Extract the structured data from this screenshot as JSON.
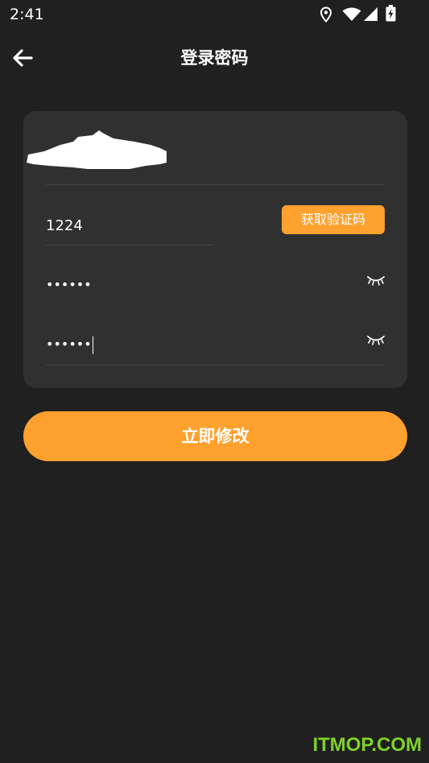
{
  "status_bar": {
    "time": "2:41",
    "icons": [
      "location-icon",
      "wifi-icon",
      "signal-icon",
      "battery-charging-icon"
    ]
  },
  "header": {
    "title": "登录密码",
    "back_icon": "arrow-left-icon"
  },
  "form": {
    "account_value_redacted": "",
    "verification_code": {
      "value": "1224"
    },
    "get_code_button": {
      "label": "获取验证码"
    },
    "password": {
      "masked_value": "••••••",
      "toggle_icon": "eye-closed-icon"
    },
    "confirm_password": {
      "masked_value": "••••••",
      "toggle_icon": "eye-closed-icon"
    }
  },
  "submit_button": {
    "label": "立即修改"
  },
  "watermark": {
    "text": "ITMOP.COM"
  },
  "colors": {
    "background": "#202020",
    "card": "#303030",
    "accent": "#ffa12f",
    "divider": "#444444",
    "watermark": "#7fd12a"
  }
}
